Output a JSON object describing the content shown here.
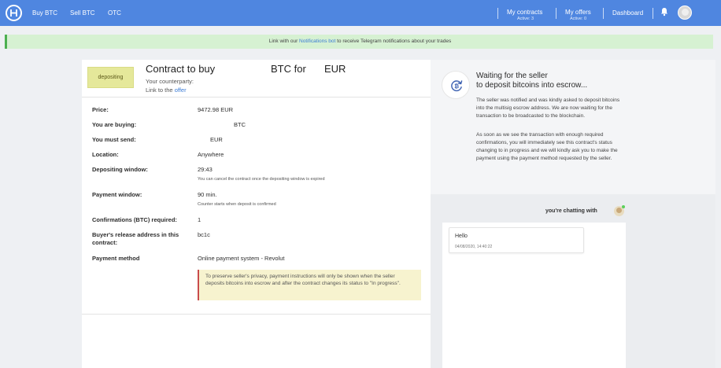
{
  "nav": {
    "links": [
      "Buy BTC",
      "Sell BTC",
      "OTC"
    ],
    "contracts_label": "My contracts",
    "contracts_sub": "Active: 3",
    "offers_label": "My offers",
    "offers_sub": "Active: 0",
    "dashboard_label": "Dashboard",
    "brand_color": "#4f86e0"
  },
  "banner": {
    "pre": "Link with our ",
    "link": "Notifications bot",
    "post": " to receive Telegram notifications about your trades"
  },
  "contract": {
    "status": "depositing",
    "title": "Contract to buy",
    "btc_label": "BTC for",
    "eur_label": "EUR",
    "counterparty": "Your counterparty:",
    "offer_prefix": "Link to the ",
    "offer_link": "offer"
  },
  "details": {
    "price_label": "Price:",
    "price_value": "9472.98 EUR",
    "buying_label": "You are buying:",
    "buying_value": "BTC",
    "send_label": "You must send:",
    "send_value": "EUR",
    "location_label": "Location:",
    "location_value": "Anywhere",
    "depositing_label": "Depositing window:",
    "depositing_value": "29:43",
    "depositing_note": "You can cancel the contract once the depositing window is expired",
    "payment_window_label": "Payment window:",
    "payment_window_value": "90 min.",
    "payment_window_note": "Counter starts when deposit is confirmed",
    "confirmations_label": "Confirmations (BTC) required:",
    "confirmations_value": "1",
    "release_label_1": "Buyer's release address in this",
    "release_label_2": "contract:",
    "release_value": "bc1c",
    "method_label": "Payment method",
    "method_value": "Online payment system - Revolut",
    "privacy_note": "To preserve seller's privacy, payment instructions will only be shown when the seller deposits bitcoins into escrow and after the contract changes its status to \"In progress\"."
  },
  "waiting": {
    "title_1": "Waiting for the seller",
    "title_2": "to deposit bitcoins into escrow...",
    "p1": "The seller was notified and was kindly asked to deposit bitcoins into the multisig escrow address. We are now waiting for the transaction to be broadcasted to the blockchain.",
    "p2": "As soon as we see the transaction with enough required confirmations, you will immediately see this contract's status changing to in progress and we will kindly ask you to make the payment using the payment method requested by the seller."
  },
  "chat": {
    "with_label": "you're chatting with",
    "message_text": "Hello",
    "message_time": "04/08/2020, 14:40:22"
  }
}
